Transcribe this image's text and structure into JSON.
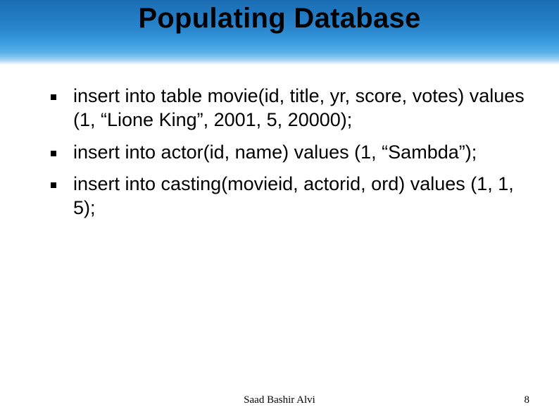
{
  "title": "Populating Database",
  "bullets": [
    "insert into table movie(id, title, yr, score, votes) values (1, “Lione King”, 2001, 5, 20000);",
    "insert into actor(id, name) values (1, “Sambda”);",
    "insert into casting(movieid, actorid, ord) values (1, 1, 5);"
  ],
  "footer": {
    "author": "Saad Bashir Alvi",
    "page": "8"
  }
}
